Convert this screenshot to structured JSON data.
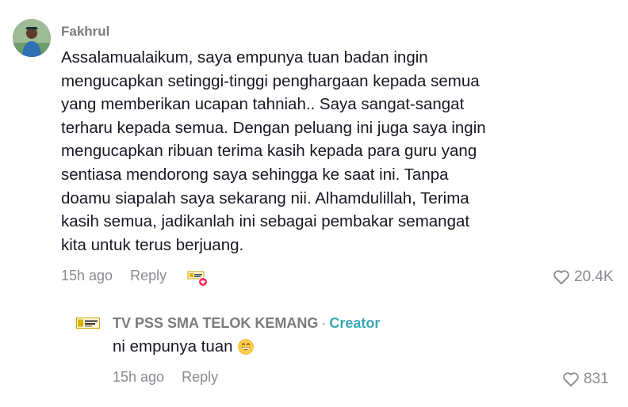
{
  "comment": {
    "author": "Fakhrul",
    "lines": [
      "Assalamualaikum, saya empunya tuan badan ingin",
      "mengucapkan setinggi-tinggi penghargaan kepada semua",
      "yang memberikan ucapan tahniah.. Saya sangat-sangat",
      "terharu kepada semua. Dengan peluang ini juga saya ingin",
      "mengucapkan ribuan terima kasih kepada para guru yang",
      "sentiasa mendorong saya sehingga ke saat ini. Tanpa",
      "doamu siapalah saya sekarang nii. Alhamdulillah, Terima",
      "kasih semua, jadikanlah ini sebagai pembakar semangat",
      "kita untuk terus berjuang."
    ],
    "time": "15h ago",
    "reply_label": "Reply",
    "likes": "20.4K"
  },
  "reply": {
    "author": "TV PSS SMA TELOK KEMANG",
    "separator": "·",
    "badge": "Creator",
    "text": "ni empunya tuan",
    "emoji": "grinning-face-emoji",
    "time": "15h ago",
    "reply_label": "Reply",
    "likes": "831"
  },
  "colors": {
    "text": "#161823",
    "muted": "#8a8b91",
    "creator": "#3aa8b5",
    "like_heart": "#fe2c55"
  }
}
